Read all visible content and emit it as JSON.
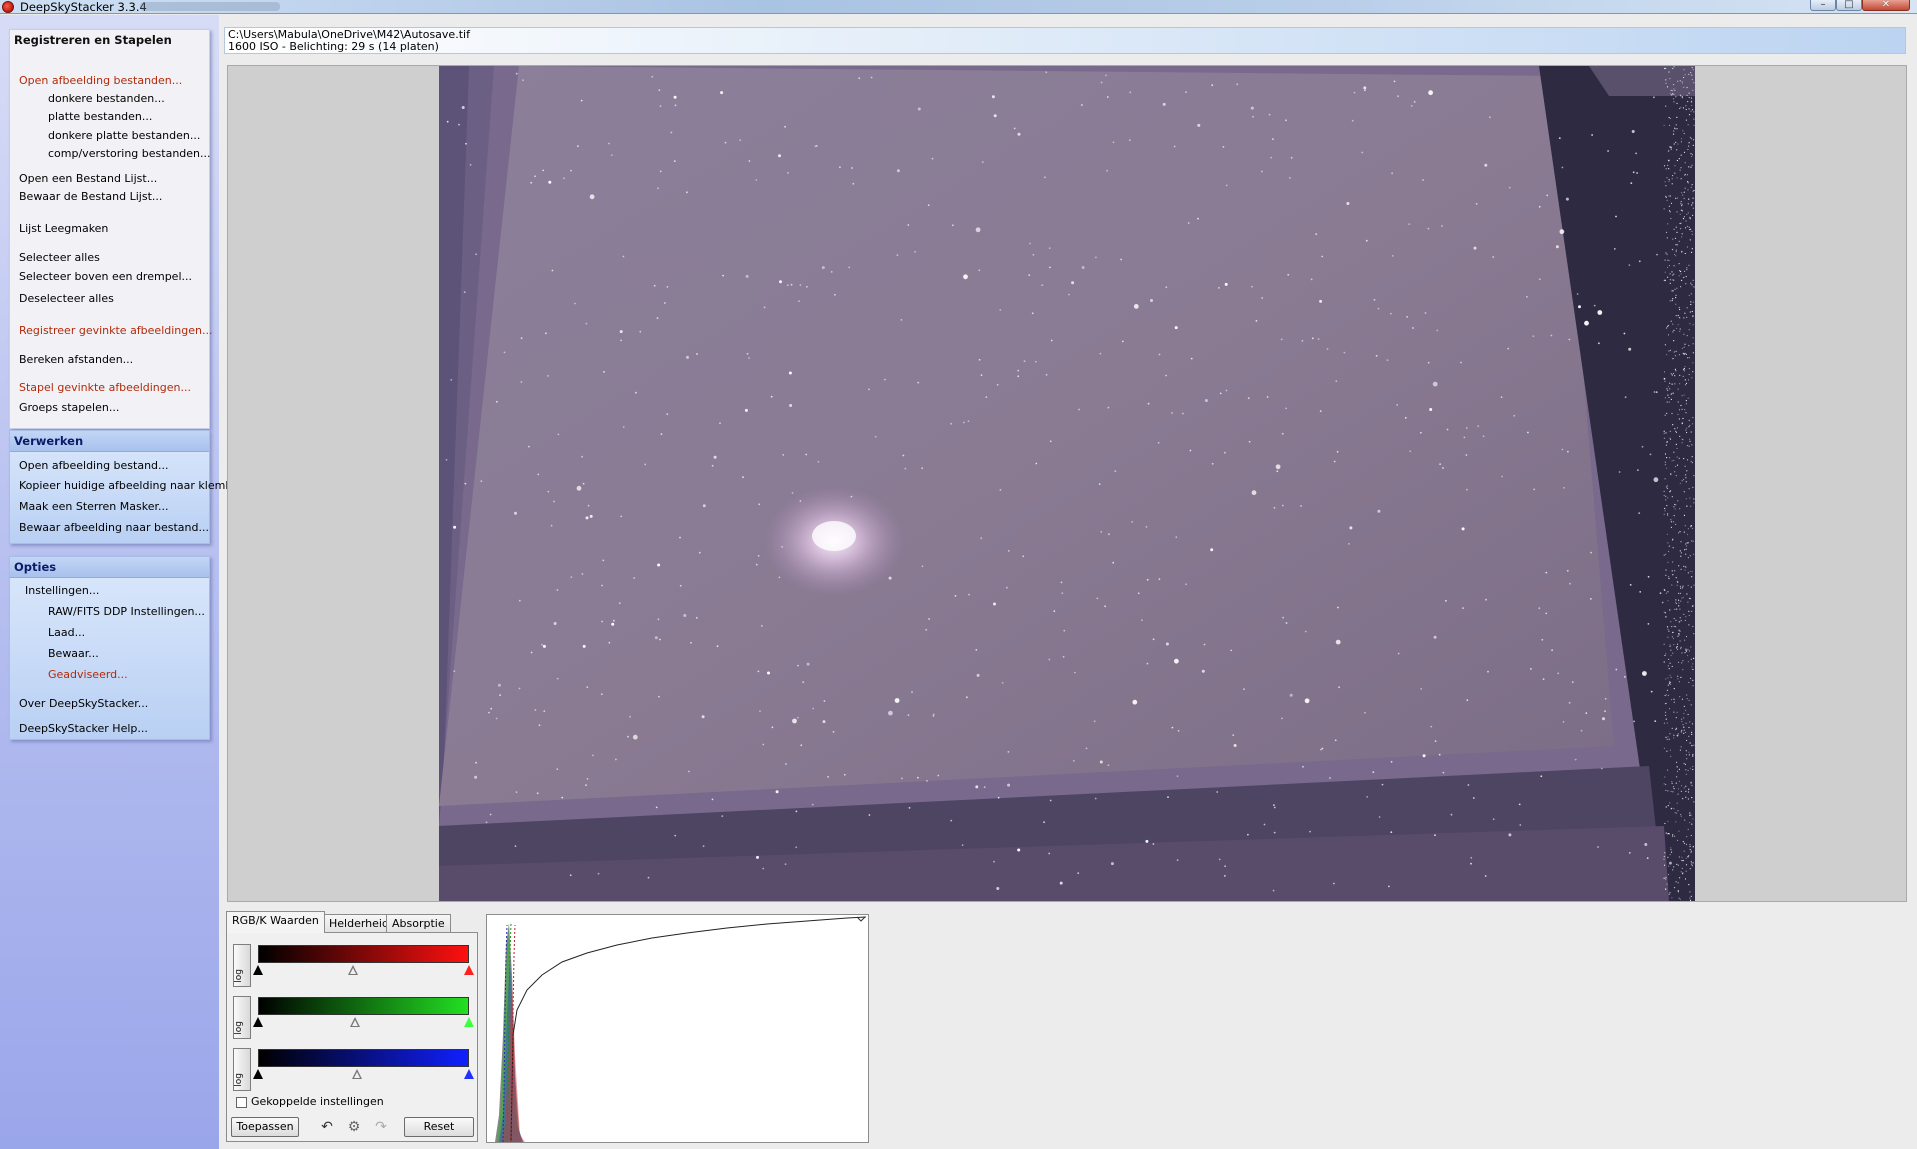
{
  "window": {
    "title": "DeepSkyStacker 3.3.4",
    "controls": {
      "minimize": "–",
      "maximize": "□",
      "close": "✕"
    }
  },
  "sidebar": {
    "register_panel": {
      "title": "Registreren en Stapelen",
      "items": [
        "Open afbeelding bestanden...",
        "donkere bestanden...",
        "platte bestanden...",
        "donkere platte bestanden...",
        "comp/verstoring bestanden...",
        "Open een Bestand Lijst...",
        "Bewaar de Bestand Lijst...",
        "Lijst Leegmaken",
        "Selecteer alles",
        "Selecteer boven een drempel...",
        "Deselecteer alles",
        "Registreer gevinkte afbeeldingen...",
        "Bereken afstanden...",
        "Stapel gevinkte afbeeldingen...",
        "Groeps stapelen..."
      ]
    },
    "process_panel": {
      "title": "Verwerken",
      "items": [
        "Open afbeelding bestand...",
        "Kopieer huidige afbeelding naar klembord",
        "Maak een Sterren Masker...",
        "Bewaar afbeelding naar bestand..."
      ]
    },
    "options_panel": {
      "title": "Opties",
      "items": [
        "Instellingen...",
        "RAW/FITS DDP Instellingen...",
        "Laad...",
        "Bewaar...",
        "Geadviseerd...",
        "Over DeepSkyStacker...",
        "DeepSkyStacker Help..."
      ]
    }
  },
  "info": {
    "path": "C:\\Users\\Mabula\\OneDrive\\M42\\Autosave.tif",
    "details": "1600 ISO - Belichting: 29 s (14 platen)"
  },
  "tabs": [
    "RGB/K Waarden",
    "Helderheid",
    "Absorptie"
  ],
  "levels": {
    "log_label": "log",
    "linked_label": "Gekoppelde instellingen",
    "linked_checked": false,
    "apply_label": "Toepassen",
    "reset_label": "Reset",
    "channels": [
      {
        "name": "red",
        "black": 0.0,
        "mid": 0.45,
        "white": 1.0
      },
      {
        "name": "green",
        "black": 0.0,
        "mid": 0.46,
        "white": 1.0
      },
      {
        "name": "blue",
        "black": 0.0,
        "mid": 0.47,
        "white": 1.0
      }
    ]
  },
  "icons": {
    "undo": "undo-icon",
    "settings": "settings-icon",
    "redo": "redo-icon"
  },
  "colors": {
    "highlight_text": "#b22a0a",
    "image_background": "#6a5a7e"
  }
}
